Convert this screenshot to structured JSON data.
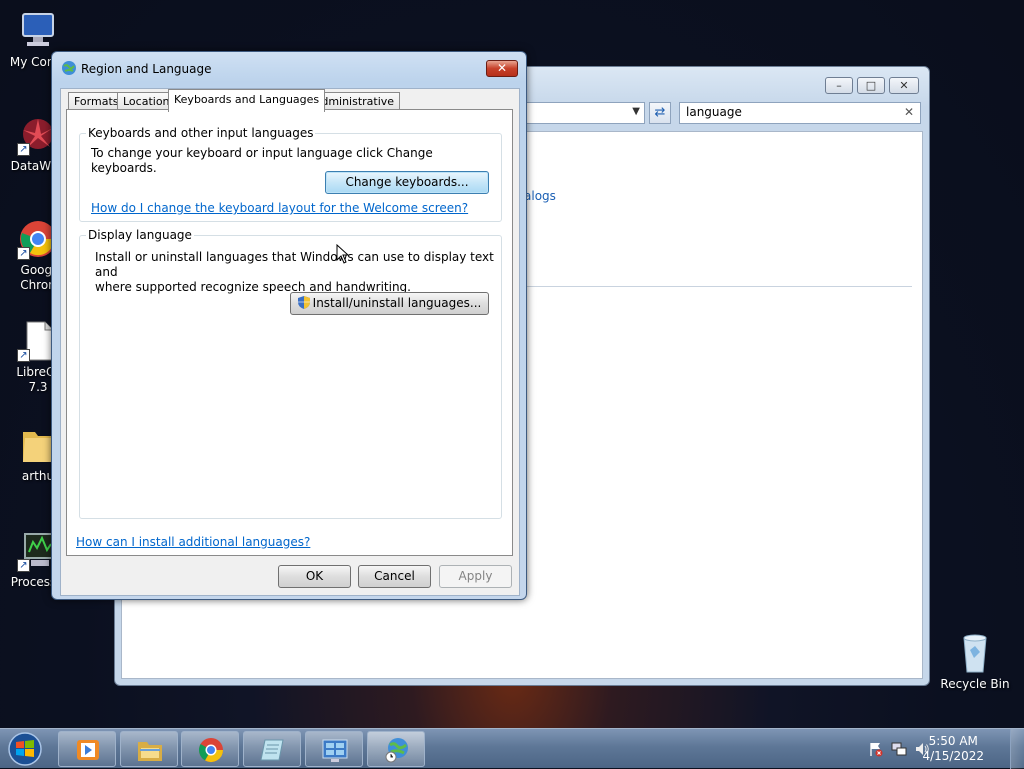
{
  "desktop": {
    "icons": [
      {
        "label_lines": [
          "My Comp"
        ]
      },
      {
        "label_lines": [
          "DataWag"
        ]
      },
      {
        "label_lines": [
          "Googl",
          "Chron"
        ]
      },
      {
        "label_lines": [
          "LibreOf",
          "7.3"
        ]
      },
      {
        "label_lines": [
          "arthu"
        ]
      },
      {
        "label_lines": [
          "ProcessH"
        ]
      },
      {
        "label_lines": [
          "Recycle Bin"
        ]
      }
    ]
  },
  "background_window": {
    "search_value": "language",
    "link_fragment": "alogs",
    "buttons": {
      "minimize": "–",
      "maximize": "□",
      "close": "✕"
    }
  },
  "dialog": {
    "title": "Region and Language",
    "close_symbol": "✕",
    "tabs": [
      "Formats",
      "Location",
      "Keyboards and Languages",
      "Administrative"
    ],
    "active_tab": "Keyboards and Languages",
    "keyboards_group": {
      "title": "Keyboards and other input languages",
      "description": "To change your keyboard or input language click Change keyboards.",
      "button": "Change keyboards...",
      "link": "How do I change the keyboard layout for the Welcome screen?"
    },
    "display_group": {
      "title": "Display language",
      "description_line1": "Install or uninstall languages that Windows can use to display text and",
      "description_line2": "where supported recognize speech and handwriting.",
      "button": "Install/uninstall languages..."
    },
    "bottom_link": "How can I install additional languages?",
    "buttons": {
      "ok": "OK",
      "cancel": "Cancel",
      "apply": "Apply"
    }
  },
  "taskbar": {
    "time": "5:50 AM",
    "date": "4/15/2022",
    "pinned": [
      "media-player-icon",
      "file-explorer-icon",
      "chrome-icon",
      "notepad-icon",
      "control-panel-icon",
      "region-globe-icon"
    ]
  },
  "colors": {
    "link": "#0066cc",
    "close_button": "#c7412a",
    "taskbar": "#5e7797"
  }
}
